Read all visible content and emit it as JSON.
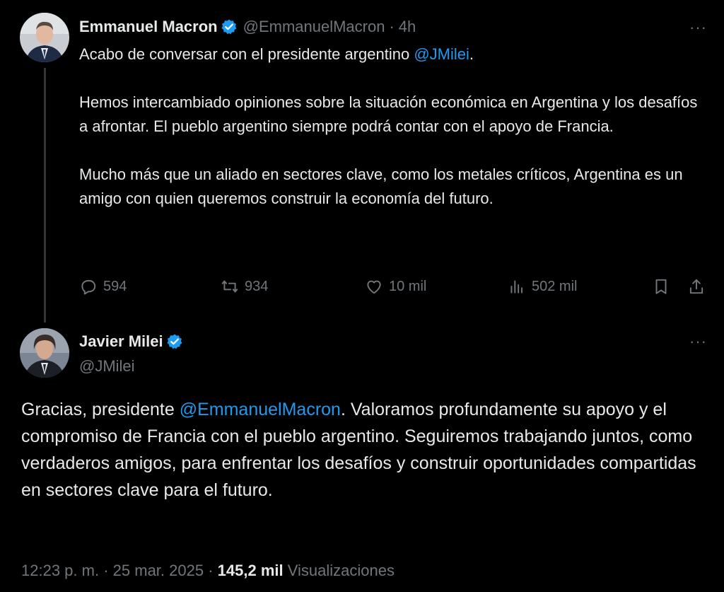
{
  "tweet1": {
    "name": "Emmanuel Macron",
    "handle": "@EmmanuelMacron",
    "separator": "·",
    "time": "4h",
    "more_label": "···",
    "line1_prefix": "Acabo de conversar con el presidente argentino ",
    "line1_mention": "@JMilei",
    "line1_suffix": ".",
    "paragraph2": "Hemos intercambiado opiniones sobre la situación económica en Argentina y los desafíos a afrontar. El pueblo argentino siempre podrá contar con el apoyo de Francia.",
    "paragraph3": "Mucho más que un aliado en sectores clave, como los metales críticos, Argentina es un amigo con quien queremos construir la economía del futuro.",
    "actions": {
      "replies": "594",
      "reposts": "934",
      "likes": "10 mil",
      "views": "502 mil"
    }
  },
  "tweet2": {
    "name": "Javier Milei",
    "handle": "@JMilei",
    "more_label": "···",
    "text_prefix": "Gracias, presidente ",
    "text_mention": "@EmmanuelMacron",
    "text_suffix": ". Valoramos profundamente su apoyo y el compromiso de Francia con el pueblo argentino. Seguiremos trabajando juntos, como verdaderos amigos, para enfrentar los desafíos y construir oportunidades compartidas en sectores clave para el futuro.",
    "meta": {
      "time": "12:23 p. m.",
      "sep1": "·",
      "date": "25 mar. 2025",
      "sep2": "·",
      "views_count": "145,2 mil",
      "views_label": "Visualizaciones"
    }
  },
  "colors": {
    "background": "#000000",
    "text": "#e7e9ea",
    "muted": "#71767b",
    "accent": "#1d9bf0"
  }
}
